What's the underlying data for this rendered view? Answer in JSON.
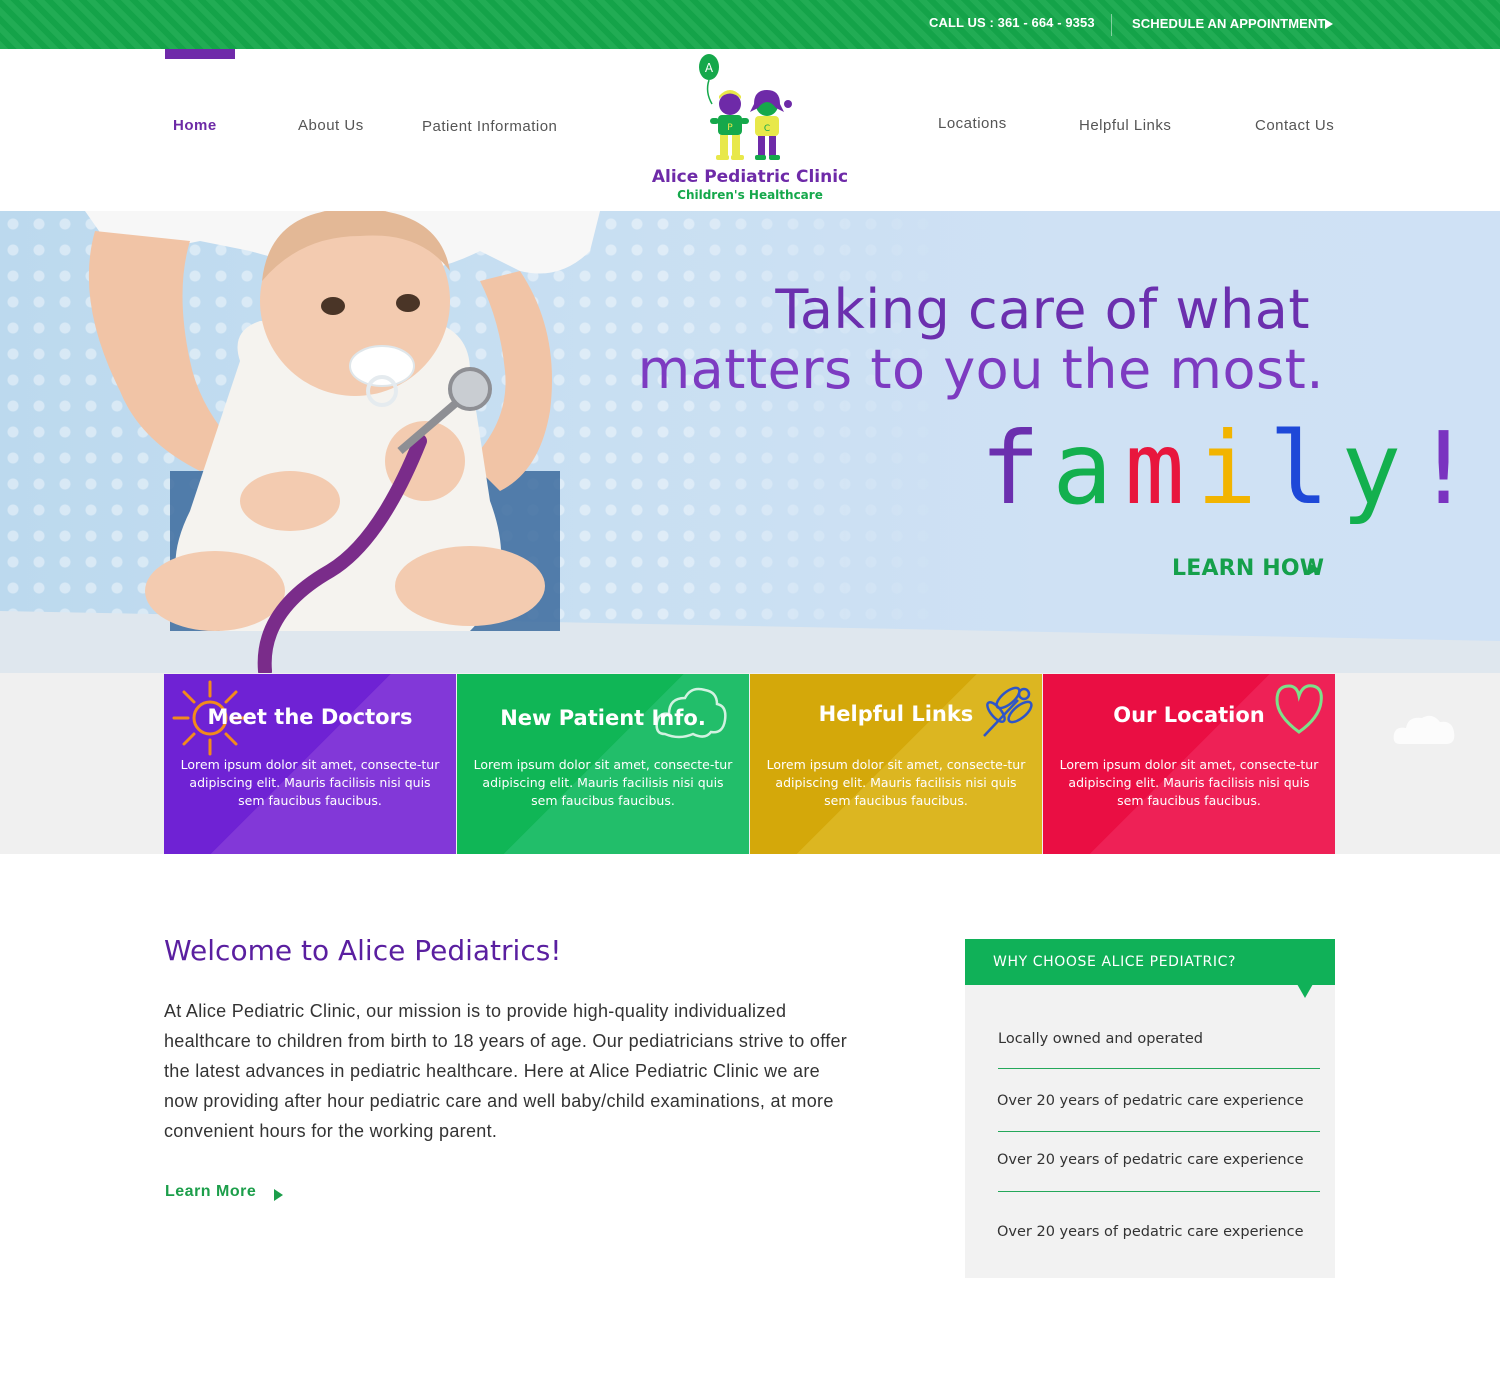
{
  "topbar": {
    "call": "CALL US : 361 - 664 - 9353",
    "appointment": "SCHEDULE AN APPOINTMENT"
  },
  "nav": {
    "home": "Home",
    "about": "About Us",
    "patient": "Patient Information",
    "locations": "Locations",
    "links": "Helpful Links",
    "contact": "Contact Us"
  },
  "logo": {
    "title": "Alice Pediatric Clinic",
    "subtitle": "Children's Healthcare",
    "balloon_letter": "A",
    "shirt_letters": [
      "P",
      "C"
    ]
  },
  "hero": {
    "line1": "Taking care of what",
    "line2": "matters to you the most.",
    "family_letters": [
      {
        "ch": "f",
        "color": "#6b2fae"
      },
      {
        "ch": "a",
        "color": "#13b04e"
      },
      {
        "ch": "m",
        "color": "#e8163d"
      },
      {
        "ch": "i",
        "color": "#f2b400"
      },
      {
        "ch": "l",
        "color": "#1e48d8"
      },
      {
        "ch": "y",
        "color": "#13b04e"
      },
      {
        "ch": "!",
        "color": "#7a33c0"
      }
    ],
    "cta": "LEARN HOW"
  },
  "cards": [
    {
      "title": "Meet the Doctors",
      "text": "Lorem ipsum dolor sit amet, consecte-tur adipiscing elit. Mauris facilisis nisi quis sem faucibus faucibus.",
      "color": "#7a2ed6",
      "icon": "sun-icon"
    },
    {
      "title": "New Patient Info.",
      "text": "Lorem ipsum dolor sit amet, consecte-tur adipiscing elit. Mauris facilisis nisi quis sem faucibus faucibus.",
      "color": "#13b75a",
      "icon": "cloud-icon"
    },
    {
      "title": "Helpful Links",
      "text": "Lorem ipsum dolor sit amet, consecte-tur adipiscing elit. Mauris facilisis nisi quis sem faucibus faucibus.",
      "color": "#d6ad0b",
      "icon": "dragonfly-icon"
    },
    {
      "title": "Our Location",
      "text": "Lorem ipsum dolor sit amet, consecte-tur adipiscing elit. Mauris facilisis nisi quis sem faucibus faucibus.",
      "color": "#ea1048",
      "icon": "heart-icon"
    }
  ],
  "welcome": {
    "title": "Welcome to Alice Pediatrics!",
    "body": "At Alice Pediatric Clinic, our mission is to provide high-quality individualized healthcare to children from birth to 18 years of age. Our pediatricians strive to offer the latest advances in pediatric healthcare. Here at Alice Pediatric Clinic we are now providing after hour pediatric care and well baby/child examinations, at more convenient hours for the working parent.",
    "cta": "Learn More"
  },
  "why": {
    "title": "WHY CHOOSE ALICE PEDIATRIC?",
    "items": [
      "Locally owned and operated",
      "Over 20 years of pedatric care experience",
      "Over 20 years of pedatric care experience",
      "Over 20 years of pedatric care experience"
    ]
  },
  "colors": {
    "green": "#15a84b",
    "purple": "#6d2aa6"
  }
}
